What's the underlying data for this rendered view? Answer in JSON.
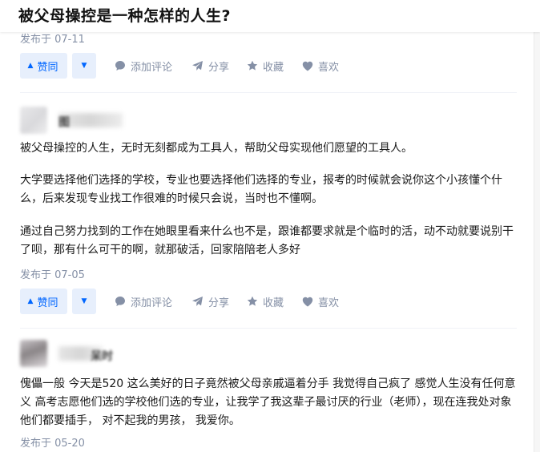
{
  "question": {
    "title": "被父母操控是一种怎样的人生?"
  },
  "actions": {
    "vote_up": "赞同",
    "comment": "添加评论",
    "share": "分享",
    "collect": "收藏",
    "like": "喜欢"
  },
  "answers": [
    {
      "date": "发布于 07-11"
    },
    {
      "author": "图",
      "paragraphs": [
        "被父母操控的人生，无时无刻都成为工具人，帮助父母实现他们愿望的工具人。",
        "大学要选择他们选择的学校，专业也要选择他们选择的专业，报考的时候就会说你这个小孩懂个什么，后来发现专业找工作很难的时候只会说，当时也不懂啊。",
        "通过自己努力找到的工作在她眼里看来什么也不是，跟谁都要求就是个临时的活，动不动就要说别干了呗，那有什么可干的啊，就那破活，回家陪陪老人多好"
      ],
      "date": "发布于 07-05"
    },
    {
      "author": "呆时",
      "paragraphs": [
        "傀儡一般 今天是520 这么美好的日子竟然被父母亲戚逼着分手 我觉得自己疯了 感觉人生没有任何意义 高考志愿他们选的学校他们选的专业，让我学了我这辈子最讨厌的行业（老师），现在连我处对象他们都要插手， 对不起我的男孩， 我爱你。"
      ],
      "date": "发布于 05-20"
    }
  ],
  "colors": {
    "accent": "#0066ff",
    "accent_bg": "#e7effc",
    "meta": "#8590a6"
  }
}
